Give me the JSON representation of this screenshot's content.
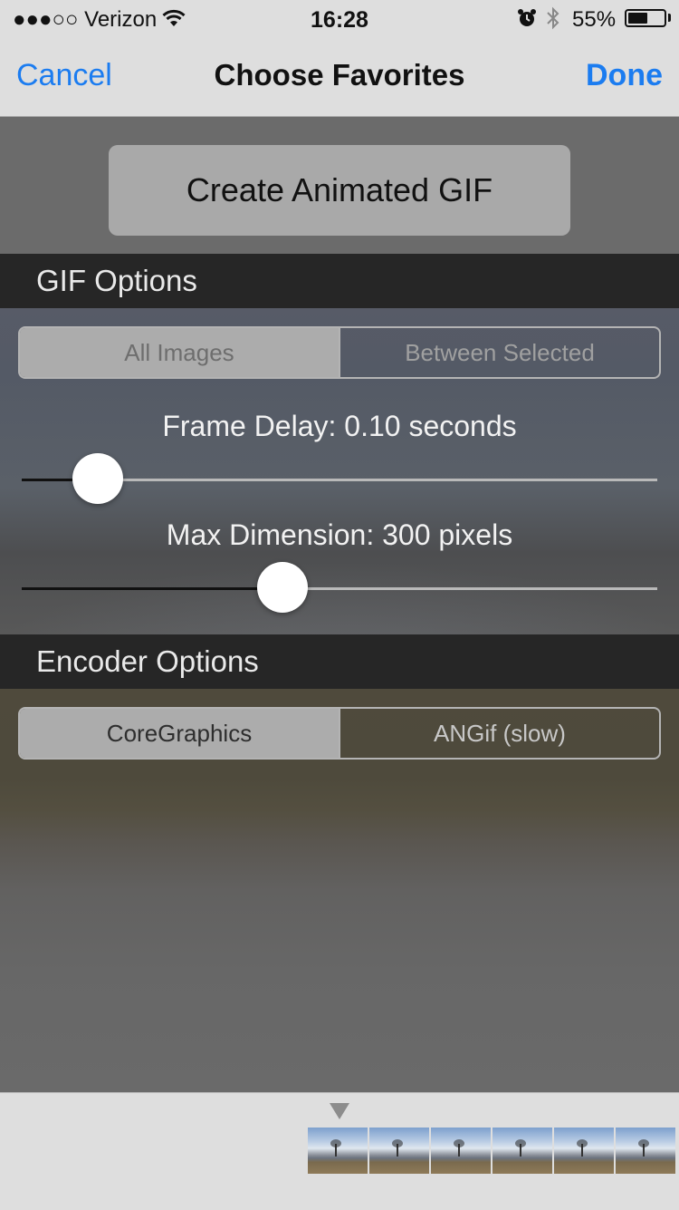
{
  "status_bar": {
    "carrier": "●●●○○ Verizon",
    "time": "16:28",
    "battery_percent": "55%",
    "battery_level": 0.55,
    "icons": [
      "wifi-icon",
      "alarm-icon",
      "bluetooth-icon",
      "battery-icon"
    ]
  },
  "nav": {
    "cancel_label": "Cancel",
    "title": "Choose Favorites",
    "done_label": "Done",
    "accent_color": "#1b7cf0"
  },
  "create_button_label": "Create Animated GIF",
  "gif_options": {
    "header": "GIF Options",
    "range_segments": [
      {
        "label": "All Images",
        "selected": true
      },
      {
        "label": "Between Selected",
        "selected": false
      }
    ],
    "frame_delay": {
      "label": "Frame Delay: 0.10 seconds",
      "fraction": 0.12
    },
    "max_dimension": {
      "label": "Max Dimension: 300 pixels",
      "fraction": 0.41
    }
  },
  "encoder_options": {
    "header": "Encoder Options",
    "segments": [
      {
        "label": "CoreGraphics",
        "selected": true
      },
      {
        "label": "ANGif (slow)",
        "selected": false
      }
    ]
  },
  "filmstrip": {
    "frame_count": 6
  }
}
